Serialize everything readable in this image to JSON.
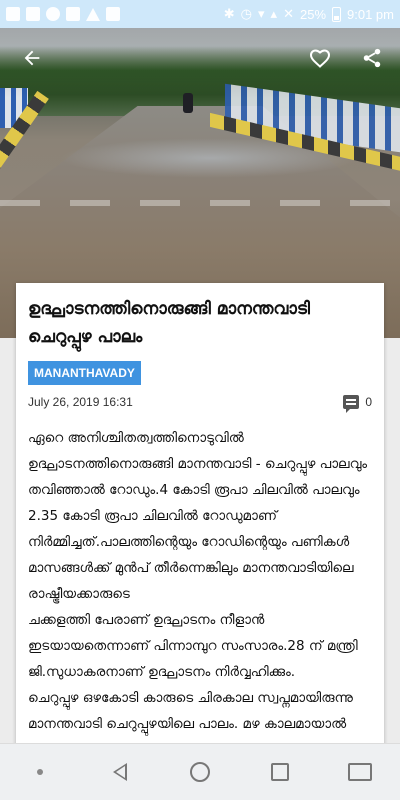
{
  "status_bar": {
    "battery": "25%",
    "time": "9:01 pm"
  },
  "article": {
    "title": "ഉദ്ഘാടനത്തിനൊരുങ്ങി മാനന്തവാടി ചെറുപ്പുഴ പാലം",
    "category": "MANANTHAVADY",
    "date": "July 26, 2019 16:31",
    "comment_count": "0",
    "body": "ഏറെ അനിശ്ചിതത്വത്തിനൊടുവിൽ ഉദ്ഘാടനത്തിനൊരുങ്ങി മാനന്തവാടി - ചെറുപ്പുഴ പാലവും തവിഞ്ഞാൽ റോഡും.4 കോടി രൂപാ ചിലവിൽ പാലവും 2.35 കോടി രൂപാ ചിലവിൽ റോഡുമാണ്\nനിർമ്മിച്ചത്.പാലത്തിന്റെയും റോഡിന്റെയും പണികൾ മാസങ്ങൾക്ക് മുൻപ് തീർന്നെങ്കിലും മാനന്തവാടിയിലെ രാഷ്ട്രീയക്കാരുടെ\nചക്കളത്തി പേരാണ് ഉദ്ഘാടനം നീളാൻ ഇടയായതെന്നാണ് പിന്നാമ്പുറ സംസാരം.28 ന് മന്ത്രി ജി.സുധാകരനാണ് ഉദ്ഘാടനം നിർവ്വഹിക്കും.\nചെറുപ്പുഴ ഒഴകോടി കാരുടെ ചിരകാല സ്വപ്നമായിരുന്നു മാനന്തവാടി ചെറുപ്പുഴയിലെ പാലം. മഴ കാലമായാൽ നിലവിലുണ്ടായിരുന്ന ചെറിയപാലം വെള്ളത്തിലാവുന്നതോടെ ഒരു"
  },
  "icons": {
    "back": "arrow-back-icon",
    "favorite": "heart-icon",
    "share": "share-icon",
    "comment": "comment-icon"
  },
  "colors": {
    "status_bar": "#cfe8fa",
    "category_badge": "#3f93e0"
  }
}
